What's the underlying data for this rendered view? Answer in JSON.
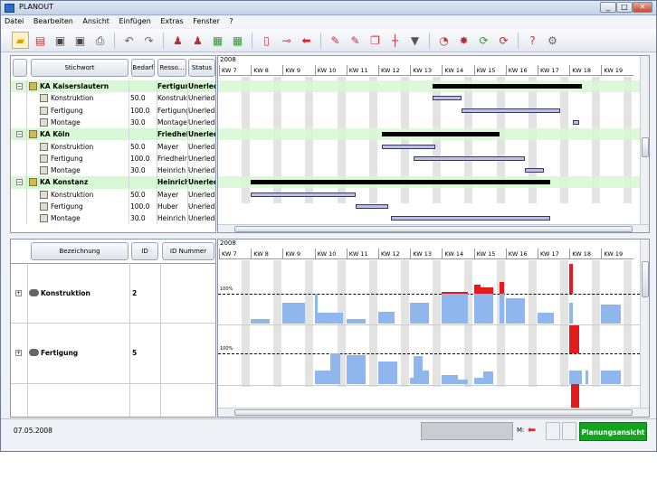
{
  "window": {
    "title": "PLANOUT",
    "min": "_",
    "max": "□",
    "close": "✕"
  },
  "menu": [
    "Datei",
    "Bearbeiten",
    "Ansicht",
    "Einfügen",
    "Extras",
    "Fenster",
    "?"
  ],
  "toolbar": {
    "icons": [
      "folder-open-icon",
      "new-icon",
      "save-icon",
      "save-as-icon",
      "print-icon",
      "undo-icon",
      "redo-icon",
      "person-add-icon",
      "person-remove-icon",
      "resource-icon",
      "resource-2-icon",
      "document-icon",
      "link-icon",
      "arrow-left-icon",
      "edit-icon",
      "edit-2-icon",
      "copy-icon",
      "columns-icon",
      "filter-icon",
      "clock-icon",
      "gear-red-icon",
      "refresh-green-icon",
      "refresh-red-icon",
      "help-icon",
      "settings-icon"
    ]
  },
  "top_table": {
    "headers": {
      "stichwort": "Stichwort",
      "bedarf": "Bedarf",
      "ressource": "Resso...",
      "status": "Status"
    },
    "rows": [
      {
        "group": true,
        "name": "KA Kaiserslautern",
        "bedarf": "",
        "ressource": "Fertigung",
        "status": "Unerled"
      },
      {
        "group": false,
        "name": "Konstruktion",
        "bedarf": "50.0",
        "ressource": "Konstruk",
        "status": "Unerled"
      },
      {
        "group": false,
        "name": "Fertigung",
        "bedarf": "100.0",
        "ressource": "Fertigung",
        "status": "Unerled"
      },
      {
        "group": false,
        "name": "Montage",
        "bedarf": "30.0",
        "ressource": "Montage",
        "status": "Unerled"
      },
      {
        "group": true,
        "name": "KA Köln",
        "bedarf": "",
        "ressource": "Friedhelr",
        "status": "Unerled"
      },
      {
        "group": false,
        "name": "Konstruktion",
        "bedarf": "50.0",
        "ressource": "Mayer",
        "status": "Unerled"
      },
      {
        "group": false,
        "name": "Fertigung",
        "bedarf": "100.0",
        "ressource": "Friedhelr",
        "status": "Unerled"
      },
      {
        "group": false,
        "name": "Montage",
        "bedarf": "30.0",
        "ressource": "Heinrich",
        "status": "Unerled"
      },
      {
        "group": true,
        "name": "KA Konstanz",
        "bedarf": "",
        "ressource": "Heinrich",
        "status": "Unerled"
      },
      {
        "group": false,
        "name": "Konstruktion",
        "bedarf": "50.0",
        "ressource": "Mayer",
        "status": "Unerled"
      },
      {
        "group": false,
        "name": "Fertigung",
        "bedarf": "100.0",
        "ressource": "Huber",
        "status": "Unerled"
      },
      {
        "group": false,
        "name": "Montage",
        "bedarf": "30.0",
        "ressource": "Heinrich",
        "status": "Unerled"
      }
    ]
  },
  "timeline": {
    "year": "2008",
    "weeks": [
      "KW 7",
      "KW 8",
      "KW 9",
      "KW 10",
      "KW 11",
      "KW 12",
      "KW 13",
      "KW 14",
      "KW 15",
      "KW 16",
      "KW 17",
      "KW 18",
      "KW 19"
    ]
  },
  "gantt": {
    "summary": [
      {
        "row": 0,
        "start": 6.7,
        "end": 11.4
      },
      {
        "row": 4,
        "start": 5.1,
        "end": 8.8
      },
      {
        "row": 8,
        "start": 1.0,
        "end": 10.4
      }
    ],
    "tasks": [
      {
        "row": 1,
        "start": 6.7,
        "end": 7.6
      },
      {
        "row": 2,
        "start": 7.6,
        "end": 10.7
      },
      {
        "row": 3,
        "start": 11.1,
        "end": 11.3
      },
      {
        "row": 5,
        "start": 5.1,
        "end": 6.8
      },
      {
        "row": 6,
        "start": 6.1,
        "end": 9.6
      },
      {
        "row": 7,
        "start": 9.6,
        "end": 10.2
      },
      {
        "row": 9,
        "start": 1.0,
        "end": 4.3
      },
      {
        "row": 10,
        "start": 4.3,
        "end": 5.3
      },
      {
        "row": 11,
        "start": 5.4,
        "end": 10.4
      }
    ]
  },
  "bottom_table": {
    "headers": {
      "bezeichnung": "Bezeichnung",
      "id": "ID",
      "idnummer": "ID Nummer"
    },
    "rows": [
      {
        "name": "Konstruktion",
        "id": "2",
        "idnummer": ""
      },
      {
        "name": "Fertigung",
        "id": "5",
        "idnummer": ""
      }
    ]
  },
  "capacity": {
    "label": "100%",
    "konstruktion": [
      [
        1,
        1.6,
        0.15
      ],
      [
        2,
        2.7,
        0.7
      ],
      [
        3,
        3.1,
        1.0
      ],
      [
        3.1,
        3.9,
        0.35
      ],
      [
        4,
        4.6,
        0.15
      ],
      [
        5,
        5.5,
        0.4
      ],
      [
        6,
        6.6,
        0.7
      ],
      [
        7,
        7.8,
        1.0
      ],
      [
        8,
        8.6,
        1.2
      ],
      [
        8.8,
        8.95,
        1.0
      ],
      [
        9,
        9.6,
        0.85
      ],
      [
        10,
        10.5,
        0.35
      ],
      [
        11,
        11.1,
        0.7
      ],
      [
        12,
        12.6,
        0.65
      ]
    ],
    "konstruktion_over": [
      [
        7,
        7.8,
        0.05
      ],
      [
        8,
        8.2,
        0.3
      ],
      [
        8.2,
        8.6,
        0.2
      ],
      [
        8.8,
        8.95,
        0.4
      ],
      [
        11,
        11.1,
        1.0
      ]
    ],
    "fertigung": [
      [
        3,
        3.5,
        0.45
      ],
      [
        3.5,
        3.8,
        1.0
      ],
      [
        4,
        4.6,
        0.95
      ],
      [
        5,
        5.6,
        0.75
      ],
      [
        6,
        6.1,
        0.2
      ],
      [
        6.1,
        6.4,
        0.9
      ],
      [
        6.4,
        6.6,
        0.45
      ],
      [
        7,
        7.5,
        0.3
      ],
      [
        7.5,
        7.8,
        0.15
      ],
      [
        8,
        8.3,
        0.2
      ],
      [
        8.3,
        8.6,
        0.4
      ],
      [
        11,
        11.4,
        0.45
      ],
      [
        11.5,
        11.6,
        0.45
      ],
      [
        12,
        12.6,
        0.45
      ]
    ],
    "fertigung_over": [
      [
        11,
        11.3,
        0.9
      ]
    ]
  },
  "status": {
    "date": "07.05.2008",
    "mode_label": "M:",
    "view_button": "Planungsansicht",
    "colors": {
      "green": "#13a31e",
      "group": "#d8f7d4",
      "bar": "#b9bfe8",
      "hist": "#8fb7ee",
      "over": "#e21c1c"
    }
  }
}
